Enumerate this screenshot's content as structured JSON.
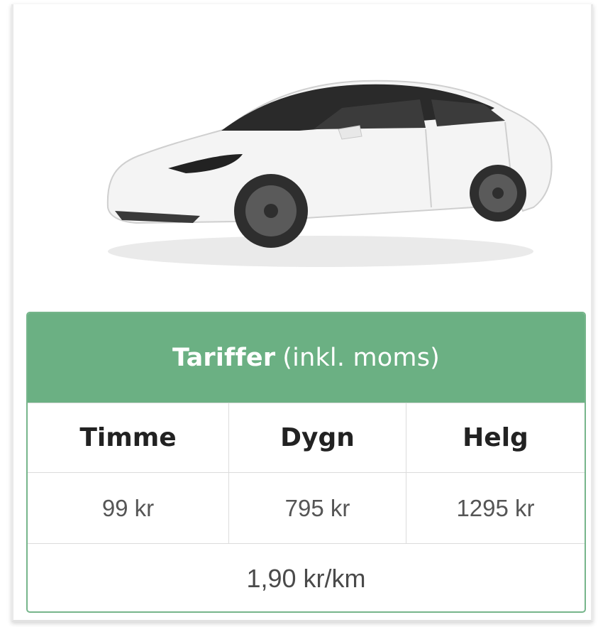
{
  "tariff": {
    "title_bold": "Tariffer",
    "title_light": "(inkl. moms)",
    "headers": [
      "Timme",
      "Dygn",
      "Helg"
    ],
    "prices": [
      "99 kr",
      "795 kr",
      "1295 kr"
    ],
    "per_km": "1,90 kr/km"
  },
  "colors": {
    "header_green": "#6bb083",
    "border_green": "#76b58b"
  },
  "image": {
    "subject": "car-image"
  }
}
